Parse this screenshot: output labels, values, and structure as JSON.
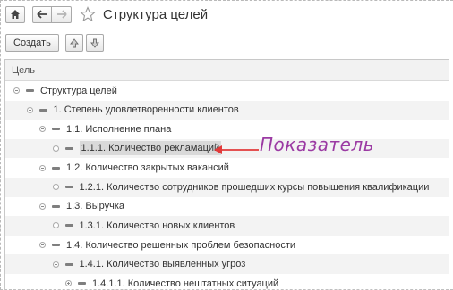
{
  "window": {
    "title": "Структура целей"
  },
  "toolbar": {
    "create_label": "Создать"
  },
  "table": {
    "column_header": "Цель",
    "rows": [
      {
        "label": "Структура целей",
        "level": 0
      },
      {
        "label": "1. Степень удовлетворенности клиентов",
        "level": 1
      },
      {
        "label": "1.1. Исполнение плана",
        "level": 2
      },
      {
        "label": "1.1.1. Количество рекламаций",
        "level": 3,
        "selected": true
      },
      {
        "label": "1.2. Количество закрытых вакансий",
        "level": 2
      },
      {
        "label": "1.2.1. Количество сотрудников прошедших курсы повышения квалификации",
        "level": 3
      },
      {
        "label": "1.3. Выручка",
        "level": 2
      },
      {
        "label": "1.3.1. Количество новых клиентов",
        "level": 3
      },
      {
        "label": "1.4. Количество решенных проблем безопасности",
        "level": 2
      },
      {
        "label": "1.4.1. Количество выявленных угроз",
        "level": 3
      },
      {
        "label": "1.4.1.1. Количество нештатных ситуаций",
        "level": 4
      }
    ]
  },
  "annotation": {
    "text": "Показатель",
    "color": "#9b3aa3"
  },
  "icons": [
    "home-icon",
    "back-arrow-icon",
    "forward-arrow-icon",
    "favorite-star-icon",
    "move-up-icon",
    "move-down-icon"
  ]
}
